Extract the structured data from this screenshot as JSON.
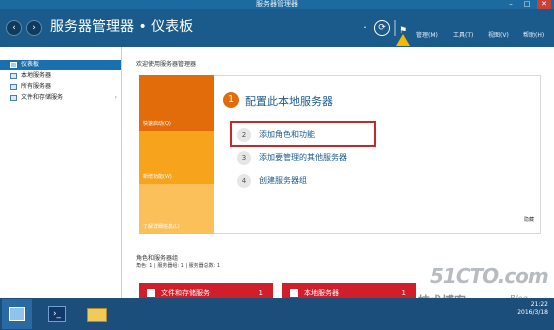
{
  "window": {
    "title": "服务器管理器"
  },
  "header": {
    "page_title": "服务器管理器 • 仪表板",
    "menu": [
      "管理(M)",
      "工具(T)",
      "视图(V)",
      "帮助(H)"
    ]
  },
  "sidebar": {
    "items": [
      {
        "label": "仪表板",
        "active": true
      },
      {
        "label": "本地服务器",
        "active": false
      },
      {
        "label": "所有服务器",
        "active": false
      },
      {
        "label": "文件和存储服务",
        "active": false,
        "has_arrow": true
      }
    ]
  },
  "main": {
    "welcome": "欢迎使用服务器管理器",
    "tiles": {
      "quick_start": "快速启动(Q)",
      "new_features": "新增功能(W)",
      "learn_more": "了解详细信息(L)"
    },
    "step1": {
      "number": "1",
      "text": "配置此本地服务器"
    },
    "steps": [
      {
        "number": "2",
        "text": "添加角色和功能"
      },
      {
        "number": "3",
        "text": "添加要管理的其他服务器"
      },
      {
        "number": "4",
        "text": "创建服务器组"
      }
    ],
    "hide_label": "隐藏",
    "section_title": "角色和服务器组",
    "section_sub": "角色: 1 | 服务器组: 1 | 服务器总数: 1",
    "cards": [
      {
        "label": "文件和存储服务",
        "count": "1"
      },
      {
        "label": "本地服务器",
        "count": "1"
      }
    ]
  },
  "watermark": {
    "line1": "51CTO.com",
    "line2": "技术博客",
    "line3": "Blog"
  },
  "taskbar": {
    "time": "21:22",
    "date": "2016/3/18"
  },
  "colors": {
    "header": "#1a5b8c",
    "accent_orange": "#e36c0a",
    "highlight_red": "#c82828",
    "card_red": "#d01f2b"
  }
}
